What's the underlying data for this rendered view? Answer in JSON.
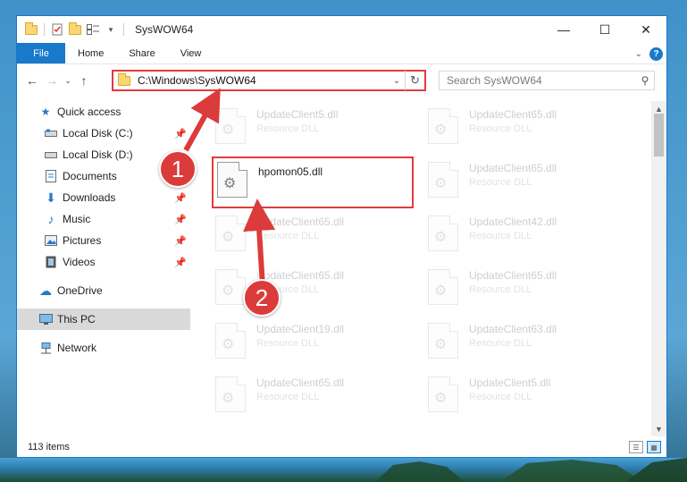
{
  "window": {
    "title": "SysWOW64",
    "controls": {
      "minimize": "—",
      "maximize": "☐",
      "close": "✕"
    }
  },
  "ribbon": {
    "tabs": [
      "File",
      "Home",
      "Share",
      "View"
    ],
    "expand_icon": "chevron-down-icon",
    "help_label": "?"
  },
  "navigation": {
    "back_icon": "arrow-left-icon",
    "forward_icon": "arrow-right-icon",
    "recent_icon": "chevron-down-icon",
    "up_icon": "arrow-up-icon"
  },
  "address_bar": {
    "path": "C:\\Windows\\SysWOW64",
    "highlight_color": "#e23a3a"
  },
  "search": {
    "placeholder": "Search SysWOW64"
  },
  "sidebar": {
    "quick_access": "Quick access",
    "items": [
      {
        "label": "Local Disk (C:)",
        "icon": "drive-icon",
        "pinned": true
      },
      {
        "label": "Local Disk (D:)",
        "icon": "drive-icon",
        "pinned": false
      },
      {
        "label": "Documents",
        "icon": "documents-icon",
        "pinned": true
      },
      {
        "label": "Downloads",
        "icon": "downloads-icon",
        "pinned": true
      },
      {
        "label": "Music",
        "icon": "music-icon",
        "pinned": true
      },
      {
        "label": "Pictures",
        "icon": "pictures-icon",
        "pinned": true
      },
      {
        "label": "Videos",
        "icon": "videos-icon",
        "pinned": true
      }
    ],
    "onedrive": "OneDrive",
    "this_pc": "This PC",
    "network": "Network"
  },
  "files": {
    "highlighted": {
      "name": "hpomon05.dll"
    },
    "faded": [
      {
        "name": "UpdateClient5.dll",
        "desc": "Resource DLL"
      },
      {
        "name": "UpdateClient65.dll",
        "desc": "Resource DLL"
      },
      {
        "name": "UpdateClient65.dll",
        "desc": "Resource DLL"
      },
      {
        "name": "UpdateClient65.dll",
        "desc": "Resource DLL"
      },
      {
        "name": "UpdateClient42.dll",
        "desc": "Resource DLL"
      },
      {
        "name": "UpdateClient65.dll",
        "desc": "Resource DLL"
      },
      {
        "name": "UpdateClient65.dll",
        "desc": "Resource DLL"
      },
      {
        "name": "UpdateClient19.dll",
        "desc": "Resource DLL"
      },
      {
        "name": "UpdateClient63.dll",
        "desc": "Resource DLL"
      },
      {
        "name": "UpdateClient65.dll",
        "desc": "Resource DLL"
      },
      {
        "name": "UpdateClient5.dll",
        "desc": "Resource DLL"
      }
    ]
  },
  "status": {
    "item_count": "113 items"
  },
  "annotations": {
    "step1": "1",
    "step2": "2",
    "color": "#dc3b3b"
  }
}
